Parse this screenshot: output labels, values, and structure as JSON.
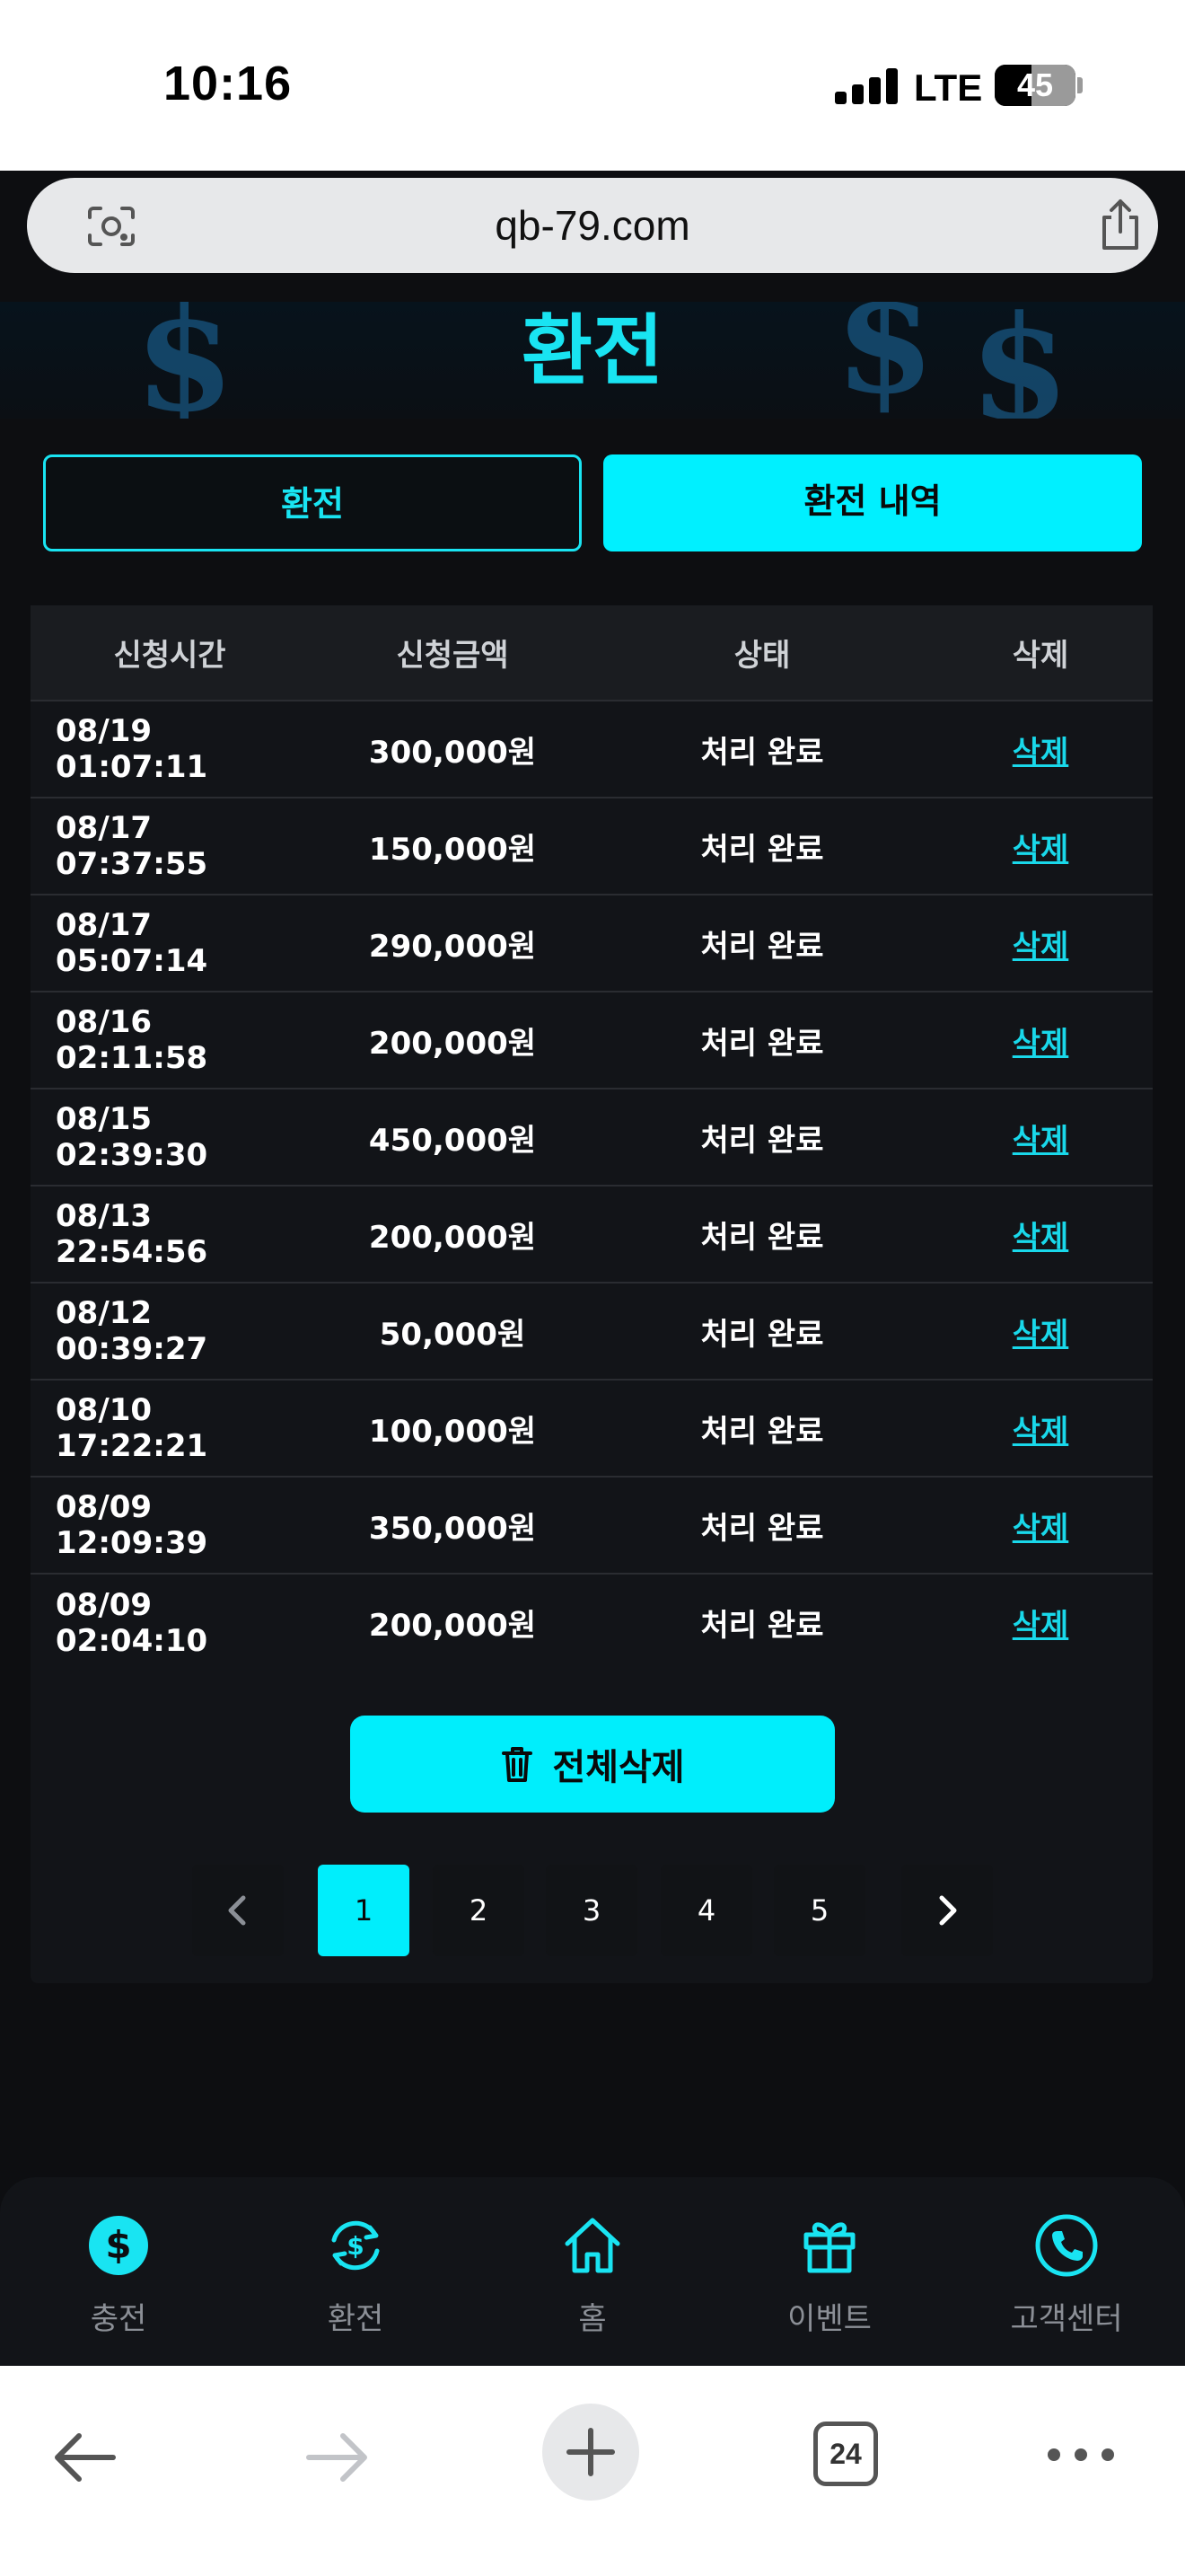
{
  "status_bar": {
    "time": "10:16",
    "network": "LTE",
    "battery": "45"
  },
  "browser": {
    "url": "qb-79.com",
    "tabs_count": "24"
  },
  "page": {
    "title": "환전"
  },
  "tabs": [
    {
      "label": "환전",
      "active": false
    },
    {
      "label": "환전 내역",
      "active": true
    }
  ],
  "table": {
    "headers": [
      "신청시간",
      "신청금액",
      "상태",
      "삭제"
    ],
    "rows": [
      {
        "time": "08/19 01:07:11",
        "amount": "300,000원",
        "status": "처리 완료",
        "delete": "삭제"
      },
      {
        "time": "08/17 07:37:55",
        "amount": "150,000원",
        "status": "처리 완료",
        "delete": "삭제"
      },
      {
        "time": "08/17 05:07:14",
        "amount": "290,000원",
        "status": "처리 완료",
        "delete": "삭제"
      },
      {
        "time": "08/16 02:11:58",
        "amount": "200,000원",
        "status": "처리 완료",
        "delete": "삭제"
      },
      {
        "time": "08/15 02:39:30",
        "amount": "450,000원",
        "status": "처리 완료",
        "delete": "삭제"
      },
      {
        "time": "08/13 22:54:56",
        "amount": "200,000원",
        "status": "처리 완료",
        "delete": "삭제"
      },
      {
        "time": "08/12 00:39:27",
        "amount": "50,000원",
        "status": "처리 완료",
        "delete": "삭제"
      },
      {
        "time": "08/10 17:22:21",
        "amount": "100,000원",
        "status": "처리 완료",
        "delete": "삭제"
      },
      {
        "time": "08/09 12:09:39",
        "amount": "350,000원",
        "status": "처리 완료",
        "delete": "삭제"
      },
      {
        "time": "08/09 02:04:10",
        "amount": "200,000원",
        "status": "처리 완료",
        "delete": "삭제"
      }
    ]
  },
  "delete_all_label": "전체삭제",
  "pagination": {
    "pages": [
      "1",
      "2",
      "3",
      "4",
      "5"
    ],
    "current": "1"
  },
  "bottom_nav": [
    {
      "label": "충전",
      "icon": "dollar-circle-icon"
    },
    {
      "label": "환전",
      "icon": "exchange-icon"
    },
    {
      "label": "홈",
      "icon": "home-icon"
    },
    {
      "label": "이벤트",
      "icon": "gift-icon"
    },
    {
      "label": "고객센터",
      "icon": "phone-icon"
    }
  ],
  "colors": {
    "accent": "#00eefc",
    "background": "#0d0e11",
    "row_bg": "#121418"
  }
}
